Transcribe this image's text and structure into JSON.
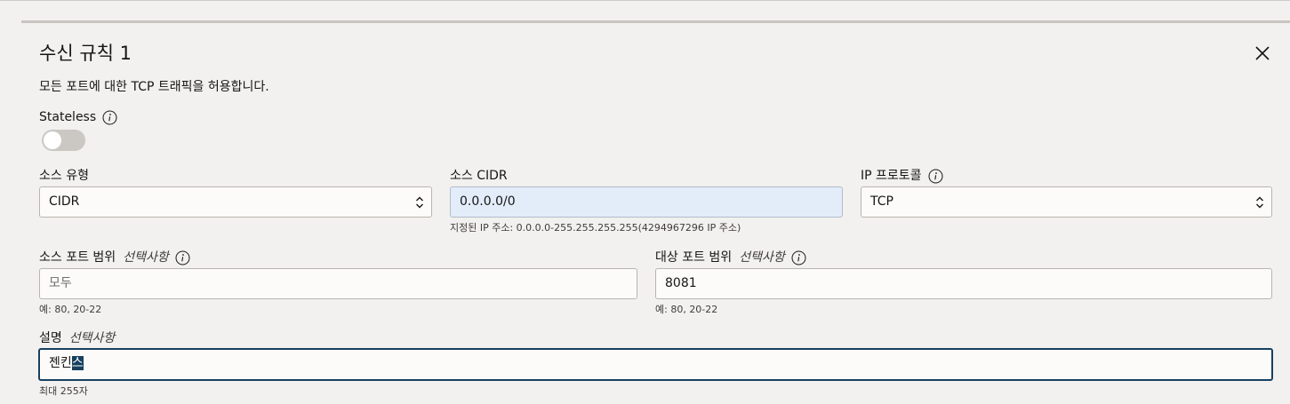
{
  "dialog": {
    "title": "수신 규칙 1",
    "description": "모든 포트에 대한 TCP 트래픽을 허용합니다."
  },
  "stateless": {
    "label": "Stateless",
    "enabled": false
  },
  "source_type": {
    "label": "소스 유형",
    "value": "CIDR"
  },
  "source_cidr": {
    "label": "소스 CIDR",
    "value": "0.0.0.0/0",
    "hint": "지정된 IP 주소: 0.0.0.0-255.255.255.255(4294967296 IP 주소)"
  },
  "ip_protocol": {
    "label": "IP 프로토콜",
    "value": "TCP"
  },
  "source_port": {
    "label": "소스 포트 범위",
    "optional": "선택사항",
    "placeholder": "모두",
    "hint": "예: 80, 20-22"
  },
  "dest_port": {
    "label": "대상 포트 범위",
    "optional": "선택사항",
    "value": "8081",
    "hint": "예: 80, 20-22"
  },
  "description_field": {
    "label": "설명",
    "optional": "선택사항",
    "value_plain": "젠킨",
    "value_selected": "스",
    "hint": "최대 255자"
  },
  "colors": {
    "focus_border": "#17405e",
    "filled_bg": "#e3edfa",
    "toggle_off": "#cbc7c2"
  }
}
